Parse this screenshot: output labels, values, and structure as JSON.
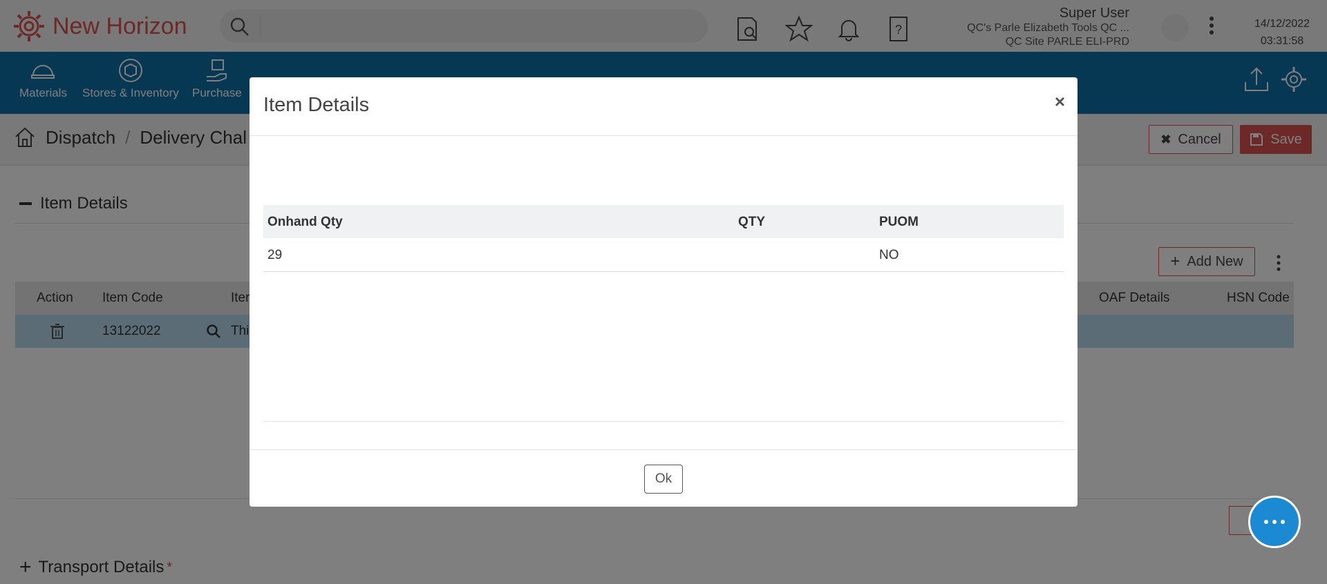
{
  "header": {
    "app_name": "New Horizon",
    "search_placeholder": "",
    "user_name": "Super User",
    "company": "QC's Parle Elizabeth Tools QC ...",
    "site": "QC Site PARLE ELI-PRD",
    "date": "14/12/2022",
    "time": "03:31:58"
  },
  "nav": {
    "items": [
      {
        "label": "Materials",
        "icon": "helmet-icon"
      },
      {
        "label": "Stores & Inventory",
        "icon": "box-icon"
      },
      {
        "label": "Purchase",
        "icon": "hand-box-icon"
      }
    ]
  },
  "breadcrumb": {
    "root": "Dispatch",
    "current": "Delivery Chal"
  },
  "actions": {
    "cancel_label": "Cancel",
    "save_label": "Save"
  },
  "item_section": {
    "title": "Item Details",
    "add_new_label": "Add New",
    "columns": [
      "Action",
      "Item Code",
      "Iter",
      "OAF Details",
      "HSN Code"
    ],
    "row": {
      "item_code": "13122022",
      "item_name": "Thi"
    }
  },
  "transport_section": {
    "title": "Transport Details",
    "required_mark": "*"
  },
  "modal": {
    "title": "Item Details",
    "close_label": "×",
    "columns": [
      "Onhand Qty",
      "QTY",
      "PUOM"
    ],
    "rows": [
      {
        "onhand_qty": "29",
        "qty": "",
        "puom": "NO"
      }
    ],
    "ok_label": "Ok"
  },
  "colors": {
    "brand_red": "#d9534f",
    "nav_blue": "#0d6ea6",
    "chat_blue": "#1b8ad3",
    "row_highlight": "#b8d9ef"
  }
}
